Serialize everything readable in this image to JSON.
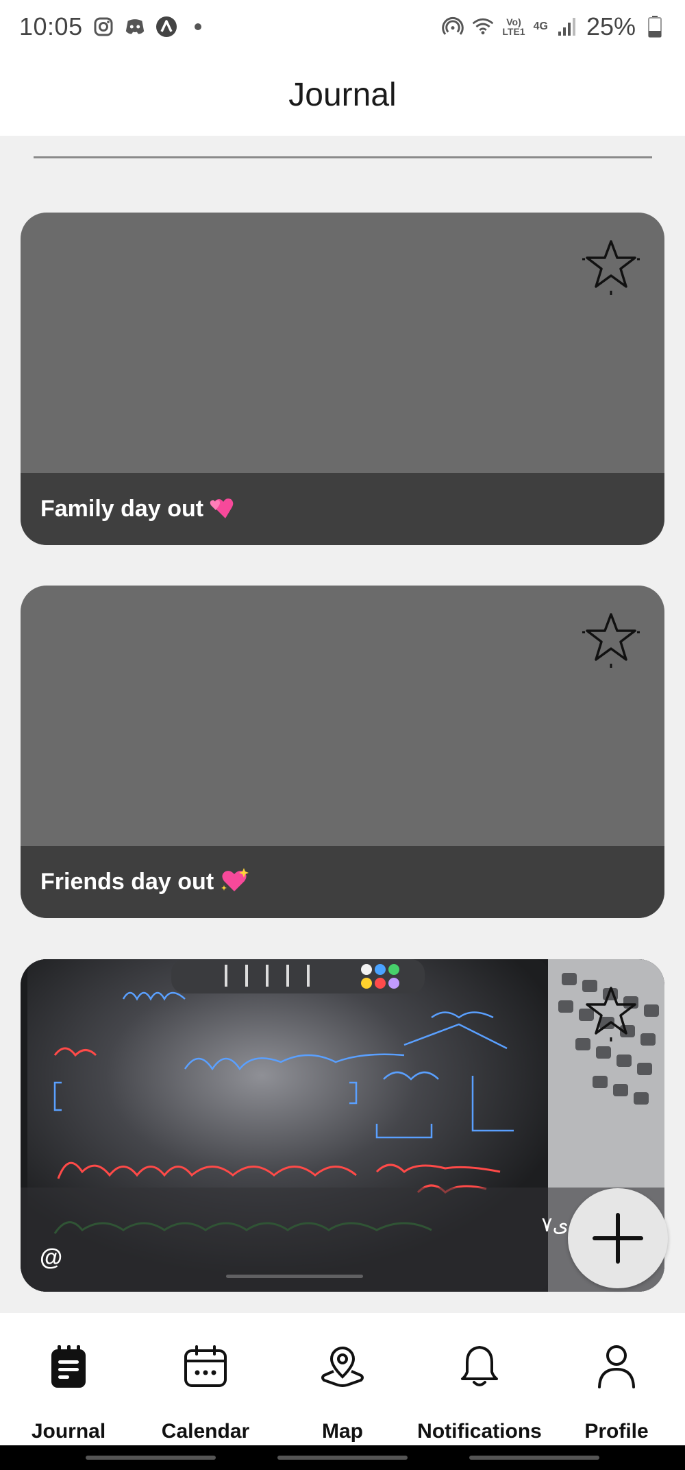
{
  "status_bar": {
    "time": "10:05",
    "battery": "25%",
    "net_top": "Vo)",
    "net_bottom": "LTE1",
    "gen_label": "4G",
    "notification_icons": [
      "instagram-icon",
      "discord-icon",
      "arc-app-icon",
      "dot-icon"
    ],
    "system_icons": [
      "hotspot-icon",
      "wifi-icon",
      "signal-icon",
      "battery-icon"
    ]
  },
  "header": {
    "title": "Journal"
  },
  "journal": {
    "entries": [
      {
        "title": "Family day out",
        "emoji": "heart-two-icon",
        "favorite": false
      },
      {
        "title": "Friends day out",
        "emoji": "heart-sparkle-icon",
        "favorite": false
      },
      {
        "title": "@",
        "extra": "ی٧",
        "has_photo": true,
        "favorite": false
      }
    ]
  },
  "fab": {
    "icon": "plus-icon"
  },
  "bottom_nav": {
    "items": [
      {
        "label": "Journal",
        "icon": "journal-icon",
        "active": true
      },
      {
        "label": "Calendar",
        "icon": "calendar-icon"
      },
      {
        "label": "Map",
        "icon": "map-pin-icon"
      },
      {
        "label": "Notifications",
        "icon": "bell-icon"
      },
      {
        "label": "Profile",
        "icon": "profile-icon"
      }
    ]
  },
  "colors": {
    "card_bg": "#6b6b6b",
    "card_footer": "#3f3f3f",
    "page_bg": "#f0f0f0",
    "heart_pink": "#f7499a"
  }
}
